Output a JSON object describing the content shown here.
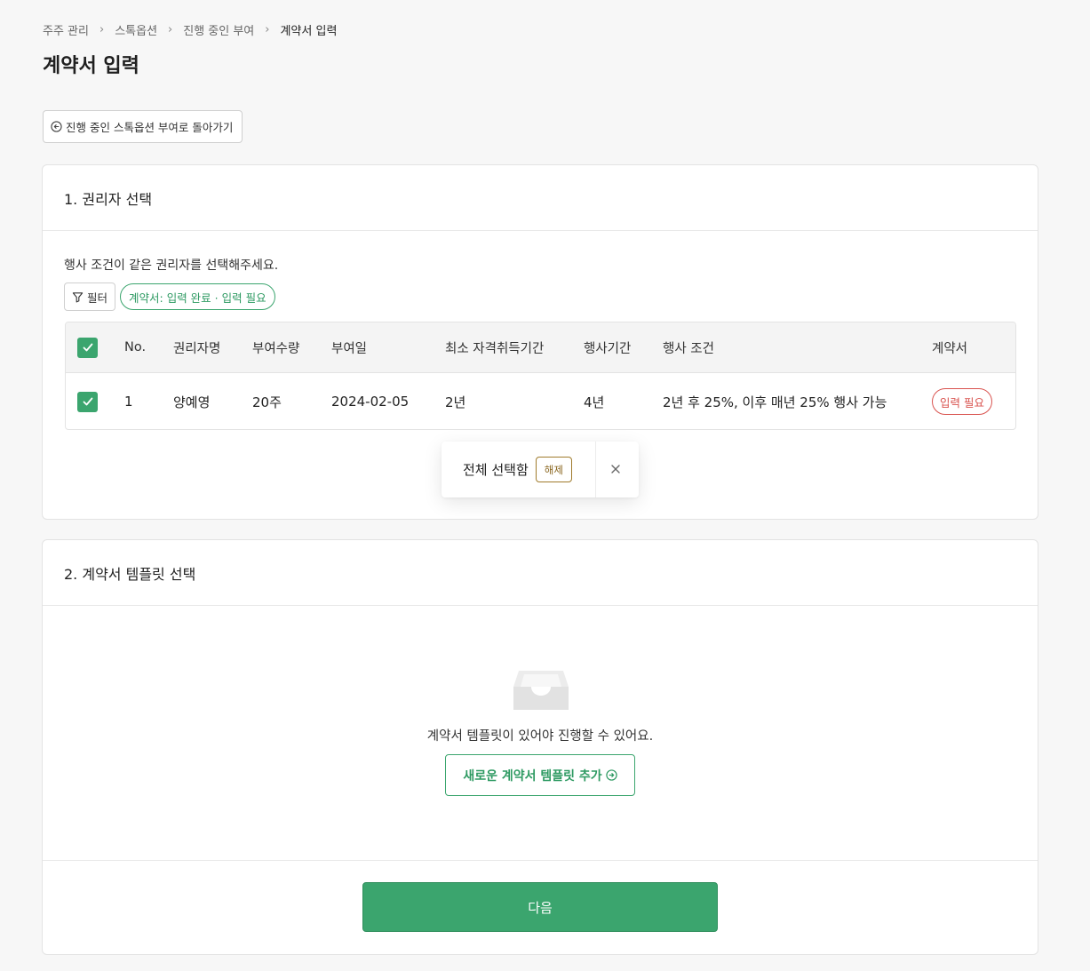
{
  "breadcrumb": [
    "주주 관리",
    "스톡옵션",
    "진행 중인 부여",
    "계약서 입력"
  ],
  "page_title": "계약서 입력",
  "back_button": "진행 중인 스톡옵션 부여로 돌아가기",
  "section1": {
    "title": "1. 권리자 선택",
    "description": "행사 조건이 같은 권리자를 선택해주세요.",
    "filter_label": "필터",
    "filter_chip": "계약서: 입력 완료 · 입력 필요",
    "columns": {
      "no": "No.",
      "name": "권리자명",
      "quantity": "부여수량",
      "date": "부여일",
      "min_period": "최소 자격취득기간",
      "exercise_period": "행사기간",
      "condition": "행사 조건",
      "contract": "계약서"
    },
    "rows": [
      {
        "no": "1",
        "name": "양예영",
        "quantity": "20주",
        "date": "2024-02-05",
        "min_period": "2년",
        "exercise_period": "4년",
        "condition": "2년 후 25%, 이후 매년 25% 행사 가능",
        "contract": "입력 필요"
      }
    ]
  },
  "selection_popup": {
    "label": "전체 선택함",
    "release": "해제"
  },
  "section2": {
    "title": "2. 계약서 템플릿 선택",
    "empty_text": "계약서 템플릿이 있어야 진행할 수 있어요.",
    "add_button": "새로운 계약서 템플릿 추가"
  },
  "next_button": "다음",
  "colors": {
    "accent": "#3ba56e",
    "danger": "#d9534f",
    "release": "#8a6720"
  }
}
